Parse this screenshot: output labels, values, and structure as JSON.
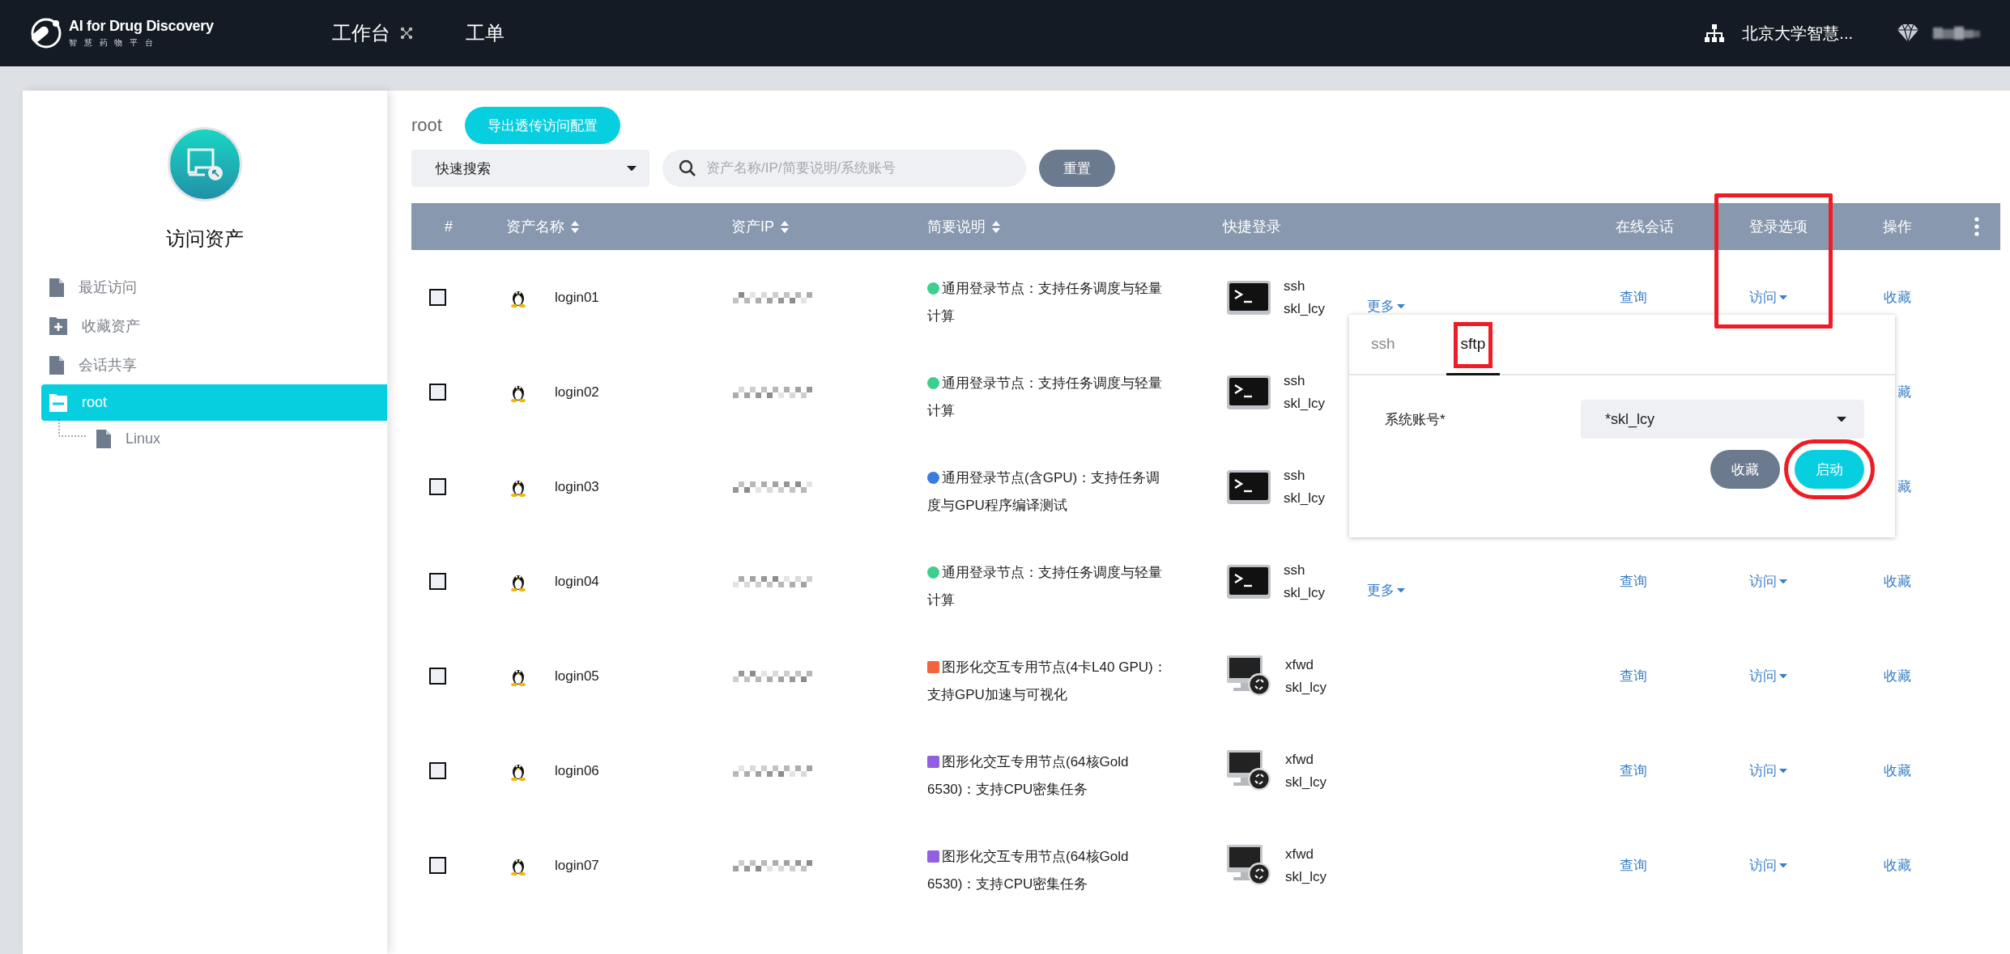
{
  "header": {
    "logo_title": "AI for Drug Discovery",
    "logo_subtitle": "智 慧 药 物 平 台",
    "nav": [
      {
        "label": "工作台",
        "has_icon": true
      },
      {
        "label": "工单",
        "has_icon": false
      }
    ],
    "org": "北京大学智慧..."
  },
  "sidebar": {
    "title": "访问资产",
    "items": [
      {
        "label": "最近访问",
        "kind": "file",
        "selected": false
      },
      {
        "label": "收藏资产",
        "kind": "plus",
        "selected": false
      },
      {
        "label": "会话共享",
        "kind": "file",
        "selected": false
      },
      {
        "label": "root",
        "kind": "folder",
        "selected": true,
        "expanded": true,
        "children": [
          {
            "label": "Linux",
            "kind": "file",
            "selected": false
          }
        ]
      }
    ]
  },
  "toolbar": {
    "breadcrumb": "root",
    "export_button": "导出透传访问配置",
    "quick_search": "快速搜索",
    "search": {
      "placeholder": "资产名称/IP/简要说明/系统账号"
    },
    "reset_button": "重置"
  },
  "table": {
    "columns": [
      {
        "label": "#",
        "sortable": false,
        "highlighted": false
      },
      {
        "label": "资产名称",
        "sortable": true,
        "highlighted": false
      },
      {
        "label": "资产IP",
        "sortable": true,
        "highlighted": false
      },
      {
        "label": "简要说明",
        "sortable": true,
        "highlighted": false
      },
      {
        "label": "快捷登录",
        "sortable": false,
        "highlighted": false
      },
      {
        "label": "在线会话",
        "sortable": false,
        "highlighted": false
      },
      {
        "label": "登录选项",
        "sortable": false,
        "highlighted": true
      },
      {
        "label": "操作",
        "sortable": false,
        "highlighted": false
      }
    ],
    "rows": [
      {
        "checked": false,
        "name": "login01",
        "tag": {
          "color": "#3ecf8e",
          "kind": "circle"
        },
        "description": "通用登录节点：支持任务调度与轻量计算",
        "kind": "terminal",
        "protocol": "ssh",
        "account": "skl_lcy",
        "more": "更多",
        "session": "查询",
        "login_option": "访问",
        "action": "收藏"
      },
      {
        "checked": false,
        "name": "login02",
        "tag": {
          "color": "#3ecf8e",
          "kind": "circle"
        },
        "description": "通用登录节点：支持任务调度与轻量计算",
        "kind": "terminal",
        "protocol": "ssh",
        "account": "skl_lcy",
        "action": "藏"
      },
      {
        "checked": false,
        "name": "login03",
        "tag": {
          "color": "#3b7be0",
          "kind": "circle"
        },
        "description": "通用登录节点(含GPU)：支持任务调度与GPU程序编译测试",
        "kind": "terminal",
        "protocol": "ssh",
        "account": "skl_lcy",
        "action": "藏"
      },
      {
        "checked": false,
        "name": "login04",
        "tag": {
          "color": "#3ecf8e",
          "kind": "circle"
        },
        "description": "通用登录节点：支持任务调度与轻量计算",
        "kind": "terminal",
        "protocol": "ssh",
        "account": "skl_lcy",
        "more": "更多",
        "session": "查询",
        "login_option": "访问",
        "action": "收藏"
      },
      {
        "checked": false,
        "name": "login05",
        "tag": {
          "color": "#f2643a",
          "kind": "square"
        },
        "description": "图形化交互专用节点(4卡L40 GPU)：支持GPU加速与可视化",
        "kind": "remote_desktop",
        "protocol": "xfwd",
        "account": "skl_lcy",
        "session": "查询",
        "login_option": "访问",
        "action": "收藏"
      },
      {
        "checked": false,
        "name": "login06",
        "tag": {
          "color": "#9060e0",
          "kind": "square"
        },
        "description": "图形化交互专用节点(64核Gold 6530)：支持CPU密集任务",
        "kind": "remote_desktop",
        "protocol": "xfwd",
        "account": "skl_lcy",
        "session": "查询",
        "login_option": "访问",
        "action": "收藏"
      },
      {
        "checked": false,
        "name": "login07",
        "tag": {
          "color": "#9060e0",
          "kind": "square"
        },
        "description": "图形化交互专用节点(64核Gold 6530)：支持CPU密集任务",
        "kind": "remote_desktop",
        "protocol": "xfwd",
        "account": "skl_lcy",
        "session": "查询",
        "login_option": "访问",
        "action": "收藏"
      }
    ]
  },
  "popup": {
    "tabs": [
      {
        "label": "ssh",
        "selected": false,
        "highlighted": false
      },
      {
        "label": "sftp",
        "selected": true,
        "highlighted": true
      }
    ],
    "field_label": "系统账号*",
    "account_value": "*skl_lcy",
    "buttons": [
      {
        "label": "收藏",
        "kind": "secondary",
        "highlighted": false
      },
      {
        "label": "启动",
        "kind": "primary",
        "highlighted": true
      }
    ]
  }
}
